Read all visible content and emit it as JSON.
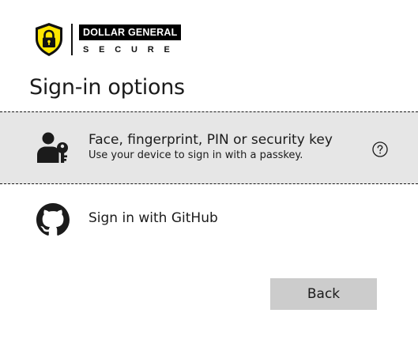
{
  "brand": {
    "name": "DOLLAR GENERAL",
    "sub": "SECURE",
    "colors": {
      "shield_yellow": "#ffe600",
      "shield_black": "#111111"
    },
    "logo_icon": "shield-lock-icon"
  },
  "page": {
    "title": "Sign-in options"
  },
  "options": [
    {
      "label": "Face, fingerprint, PIN or security key",
      "description": "Use your device to sign in with a passkey.",
      "icon": "user-key-icon",
      "help_icon": "question-circle-icon",
      "selected": true
    },
    {
      "label": "Sign in with GitHub",
      "icon": "github-icon",
      "selected": false
    }
  ],
  "actions": {
    "back_label": "Back"
  },
  "colors": {
    "selected_background": "#e6e6e6",
    "button_background": "#cccccc",
    "text": "#1b1b1b"
  }
}
